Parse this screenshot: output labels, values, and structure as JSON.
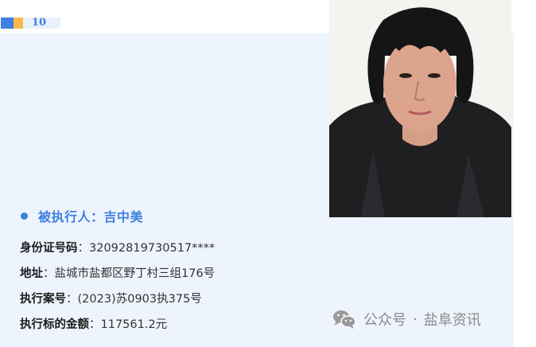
{
  "badge": {
    "number": "10"
  },
  "person": {
    "heading_label": "被执行人",
    "heading_colon": "：",
    "name": "吉中美",
    "photo": "portrait-photo"
  },
  "details": [
    {
      "label": "身份证号码",
      "colon": "：",
      "value": "32092819730517****"
    },
    {
      "label": "地址",
      "colon": "：",
      "value": "盐城市盐都区野丁村三组176号"
    },
    {
      "label": "执行案号",
      "colon": "：",
      "value": "(2023)苏0903执375号"
    },
    {
      "label": "执行标的金额",
      "colon": "：",
      "value": "117561.2元"
    }
  ],
  "watermark": {
    "icon": "wechat-icon",
    "account_type": "公众号",
    "separator": "·",
    "account_name": "盐阜资讯"
  },
  "colors": {
    "accent_blue": "#3e7fe0",
    "accent_orange": "#f7b94c",
    "panel_bg": "#eef4fd"
  }
}
